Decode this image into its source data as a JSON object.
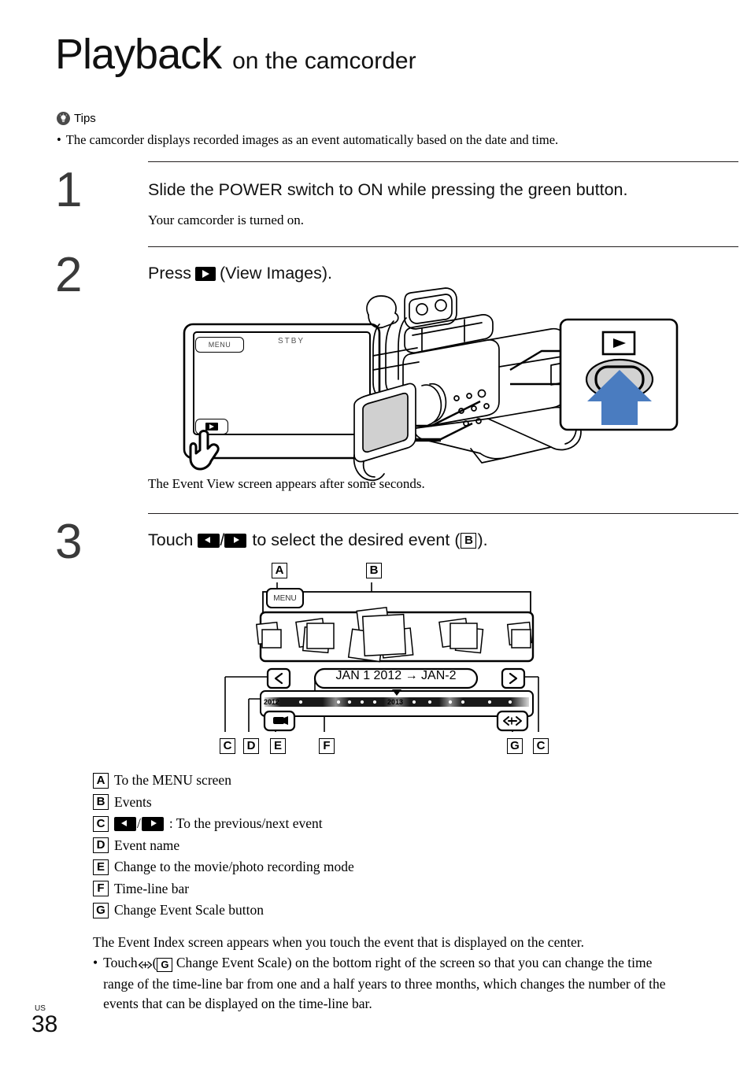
{
  "page": {
    "title_main": "Playback",
    "title_sub": "on the camcorder",
    "number": "38",
    "region_code": "US"
  },
  "tips": {
    "heading": "Tips",
    "icon": "lightbulb-icon",
    "bullet": "The camcorder displays recorded images as an event automatically based on the date and time."
  },
  "steps": [
    {
      "number": "1",
      "title": "Slide the POWER switch to ON while pressing the green button.",
      "body": "Your camcorder is turned on."
    },
    {
      "number": "2",
      "title_before": "Press",
      "title_icon": "view-images-icon",
      "title_after": "(View Images).",
      "body": "The Event View screen appears after some seconds."
    },
    {
      "number": "3",
      "title_before": "Touch",
      "title_prev_icon": "previous-event-icon",
      "title_slash": "/",
      "title_next_icon": "next-event-icon",
      "title_middle": "to select the desired event (",
      "title_ref": "B",
      "title_after": ")."
    }
  ],
  "figure_lcd": {
    "menu_button": "MENU",
    "status": "STBY",
    "play_button_icon": "view-images-icon",
    "touch_hand_icon": "pointing-hand-icon"
  },
  "figure_callout": {
    "play_button_icon": "view-images-icon",
    "arrow_icon": "up-arrow-icon",
    "arrow_color": "#4a7cc0"
  },
  "figure_eventview": {
    "labels": {
      "a": "A",
      "b": "B",
      "c": "C",
      "d": "D",
      "e": "E",
      "f": "F",
      "g": "G"
    },
    "menu_button": "MENU",
    "event_name": "JAN 1 2012 → JAN-2",
    "prev_icon": "chevron-left-icon",
    "next_icon": "chevron-right-icon",
    "timeline": {
      "start_year": "2012",
      "end_year": "2013",
      "marker_icon": "triangle-down-marker",
      "event_dots": [
        4,
        18,
        38,
        45,
        51,
        59,
        72,
        80,
        89,
        97,
        110,
        124
      ]
    },
    "record_mode_button_icon": "movie-camera-icon",
    "change_scale_button_icon": "left-right-arrow-icon"
  },
  "legend": [
    {
      "key": "A",
      "text": "To the MENU screen"
    },
    {
      "key": "B",
      "text": "Events"
    },
    {
      "key": "C",
      "text": ": To the previous/next event",
      "has_icons": true
    },
    {
      "key": "D",
      "text": "Event name"
    },
    {
      "key": "E",
      "text": "Change to the movie/photo recording mode"
    },
    {
      "key": "F",
      "text": "Time-line bar"
    },
    {
      "key": "G",
      "text": "Change Event Scale button"
    }
  ],
  "closing": {
    "paragraph": "The Event Index screen appears when you touch the event that is displayed on the center.",
    "bullet_before": "Touch",
    "bullet_icon": "left-right-arrow-icon",
    "bullet_paren_open": "(",
    "bullet_ref": "G",
    "bullet_after": "Change Event Scale) on the bottom right of the screen so that you can change the time range of the time-line bar from one and a half years to three months, which changes the number of the events that can be displayed on the time-line bar."
  }
}
